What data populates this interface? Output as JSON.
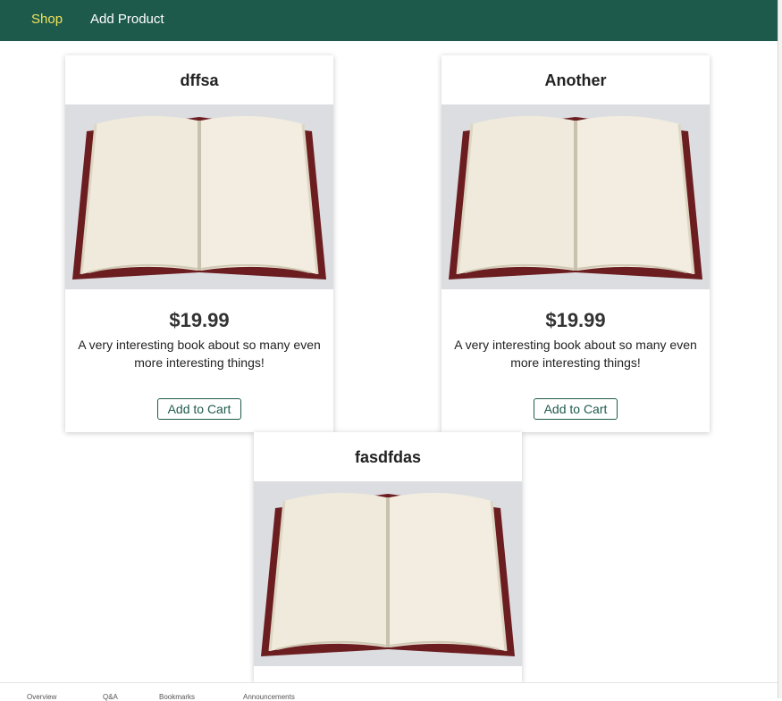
{
  "nav": {
    "items": [
      {
        "label": "Shop",
        "active": true
      },
      {
        "label": "Add Product",
        "active": false
      }
    ],
    "color": "#1e5a4c",
    "active_color": "#f1e35a"
  },
  "products": [
    {
      "title": "dffsa",
      "price": "$19.99",
      "description": "A very interesting book about so many even more interesting things!",
      "button_label": "Add to Cart"
    },
    {
      "title": "Another",
      "price": "$19.99",
      "description": "A very interesting book about so many even more interesting things!",
      "button_label": "Add to Cart"
    },
    {
      "title": "fasdfdas"
    }
  ],
  "footer_tabs": [
    "Overview",
    "Q&A",
    "Bookmarks",
    "Announcements"
  ]
}
